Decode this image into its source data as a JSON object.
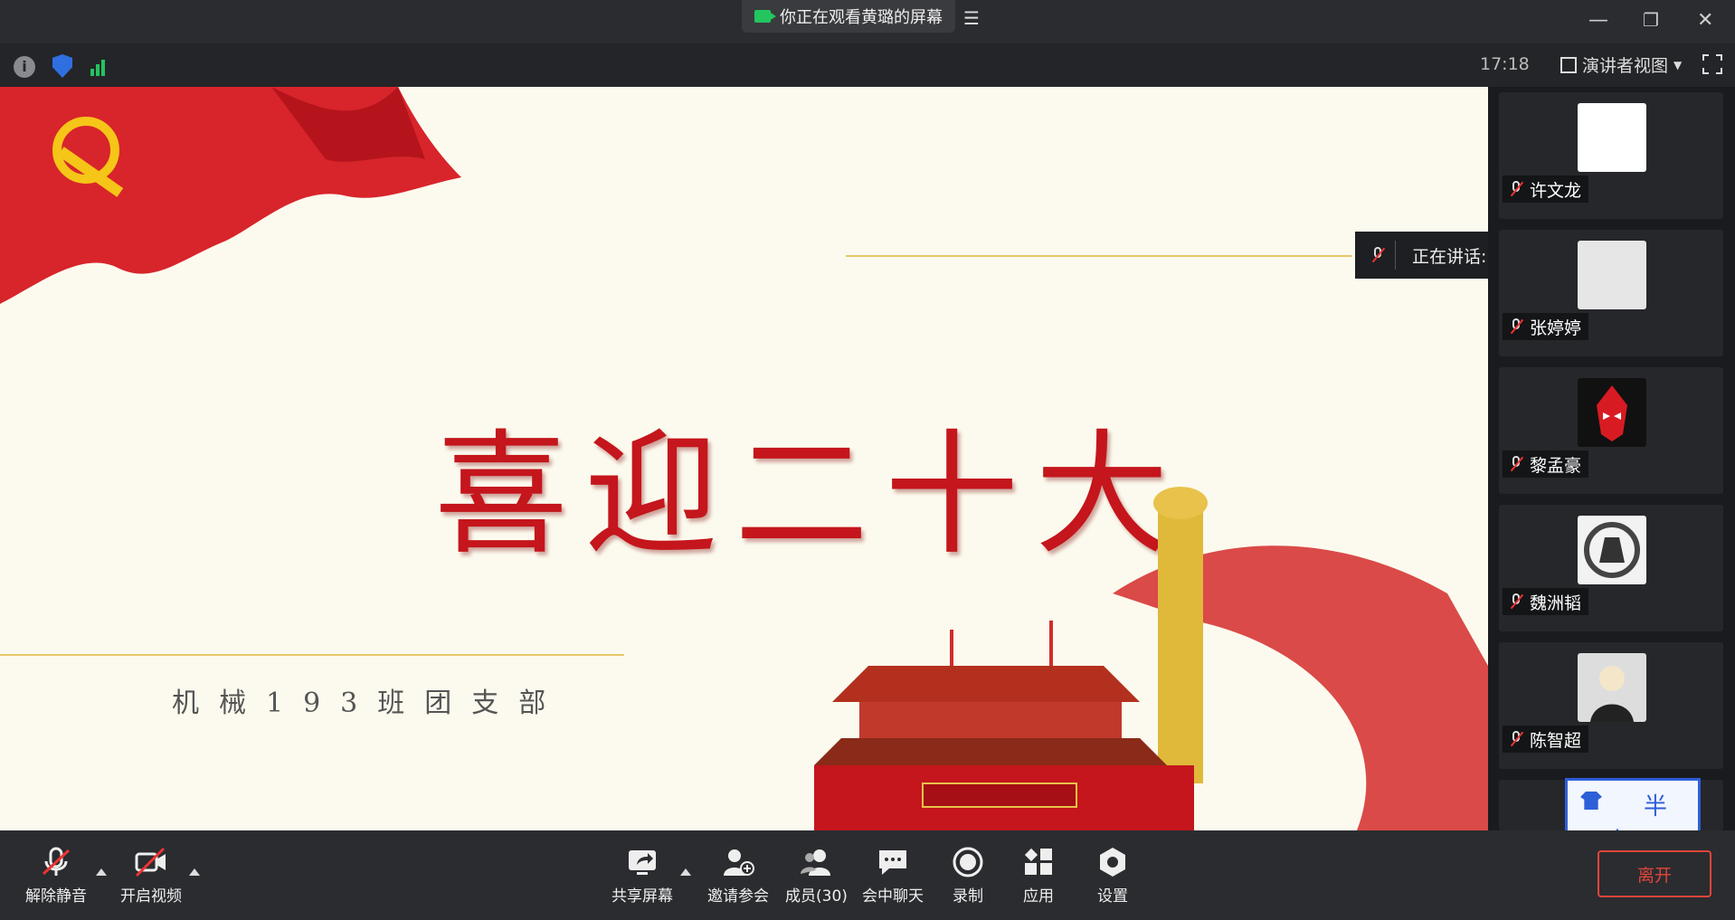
{
  "titlebar": {
    "share_status": "你正在观看黄璐的屏幕"
  },
  "infobar": {
    "time": "17:18",
    "view_mode": "演讲者视图"
  },
  "slide": {
    "title": "喜迎二十大",
    "subtitle": "机械193班团支部"
  },
  "speaking": {
    "text": "正在讲话: 黄璐;"
  },
  "participants": [
    {
      "name": "许文龙"
    },
    {
      "name": "张婷婷"
    },
    {
      "name": "黎孟豪"
    },
    {
      "name": "魏洲韬"
    },
    {
      "name": "陈智超"
    }
  ],
  "ime": {
    "char1": "半",
    "char2": "中"
  },
  "toolbar": {
    "unmute": "解除静音",
    "start_video": "开启视频",
    "share_screen": "共享屏幕",
    "invite": "邀请参会",
    "members": "成员(30)",
    "chat": "会中聊天",
    "record": "录制",
    "apps": "应用",
    "settings": "设置",
    "leave": "离开"
  },
  "colors": {
    "accent_red": "#c4161c",
    "speaking_green": "#22c55e",
    "leave_red": "#e0453a"
  }
}
